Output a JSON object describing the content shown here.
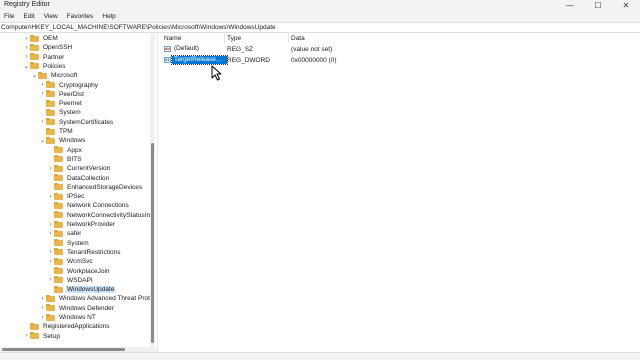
{
  "window": {
    "title": "Registry Editor",
    "minimize": "—",
    "maximize": "☐",
    "close": "✕"
  },
  "menu": [
    "File",
    "Edit",
    "View",
    "Favorites",
    "Help"
  ],
  "address": "Computer\\HKEY_LOCAL_MACHINE\\SOFTWARE\\Policies\\Microsoft\\Windows\\WindowsUpdate",
  "tree": [
    {
      "label": "OEM",
      "level": 0,
      "expander": "›"
    },
    {
      "label": "OpenSSH",
      "level": 0,
      "expander": "›"
    },
    {
      "label": "Partner",
      "level": 0,
      "expander": "›"
    },
    {
      "label": "Policies",
      "level": 0,
      "expander": "⌄"
    },
    {
      "label": "Microsoft",
      "level": 1,
      "expander": "⌄"
    },
    {
      "label": "Cryptography",
      "level": 2,
      "expander": "›"
    },
    {
      "label": "PeerDist",
      "level": 2,
      "expander": "›"
    },
    {
      "label": "Peernet",
      "level": 2,
      "expander": ""
    },
    {
      "label": "System",
      "level": 2,
      "expander": ""
    },
    {
      "label": "SystemCertificates",
      "level": 2,
      "expander": "›"
    },
    {
      "label": "TPM",
      "level": 2,
      "expander": ""
    },
    {
      "label": "Windows",
      "level": 2,
      "expander": "⌄"
    },
    {
      "label": "Appx",
      "level": 3,
      "expander": ""
    },
    {
      "label": "BITS",
      "level": 3,
      "expander": ""
    },
    {
      "label": "CurrentVersion",
      "level": 3,
      "expander": "›"
    },
    {
      "label": "DataCollection",
      "level": 3,
      "expander": ""
    },
    {
      "label": "EnhancedStorageDevices",
      "level": 3,
      "expander": ""
    },
    {
      "label": "IPSec",
      "level": 3,
      "expander": "›"
    },
    {
      "label": "Network Connections",
      "level": 3,
      "expander": ""
    },
    {
      "label": "NetworkConnectivityStatusInd",
      "level": 3,
      "expander": ""
    },
    {
      "label": "NetworkProvider",
      "level": 3,
      "expander": "›"
    },
    {
      "label": "safer",
      "level": 3,
      "expander": "›"
    },
    {
      "label": "System",
      "level": 3,
      "expander": ""
    },
    {
      "label": "TenantRestrictions",
      "level": 3,
      "expander": "›"
    },
    {
      "label": "WcmSvc",
      "level": 3,
      "expander": "›"
    },
    {
      "label": "WorkplaceJoin",
      "level": 3,
      "expander": ""
    },
    {
      "label": "WSDAPI",
      "level": 3,
      "expander": "›"
    },
    {
      "label": "WindowsUpdate",
      "level": 3,
      "expander": "",
      "selected": true
    },
    {
      "label": "Windows Advanced Threat Prote",
      "level": 2,
      "expander": "›"
    },
    {
      "label": "Windows Defender",
      "level": 2,
      "expander": "›"
    },
    {
      "label": "Windows NT",
      "level": 2,
      "expander": "›"
    },
    {
      "label": "RegisteredApplications",
      "level": 0,
      "expander": ""
    },
    {
      "label": "Setup",
      "level": 0,
      "expander": "›"
    }
  ],
  "list": {
    "columns": [
      "Name",
      "Type",
      "Data"
    ],
    "rows": [
      {
        "name": "(Default)",
        "type": "REG_SZ",
        "data": "(value not set)",
        "icon": "ab",
        "icon_name": "string-value-icon",
        "selected": false
      },
      {
        "name": "TargetReleaseVer...",
        "type": "REG_DWORD",
        "data": "0x00000000 (0)",
        "icon": "01",
        "icon_name": "dword-value-icon",
        "selected": true
      }
    ]
  },
  "colors": {
    "selection": "#0078d7",
    "folder": "#e6b64a",
    "tree_selection": "#cce4f7"
  }
}
